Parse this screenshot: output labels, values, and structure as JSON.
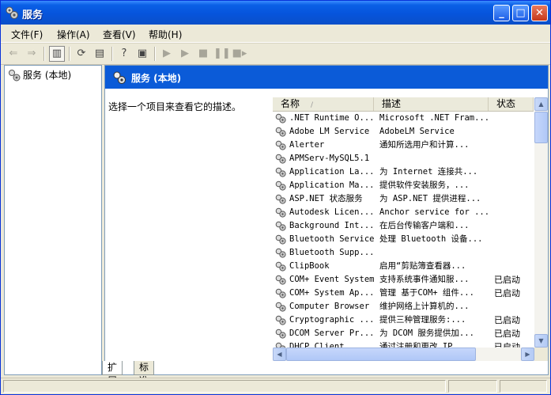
{
  "window": {
    "title": "服务"
  },
  "menu": [
    "文件(F)",
    "操作(A)",
    "查看(V)",
    "帮助(H)"
  ],
  "tree": {
    "root_label": "服务 (本地)"
  },
  "header": {
    "title": "服务 (本地)"
  },
  "description_prompt": "选择一个项目来查看它的描述。",
  "columns": {
    "name": "名称",
    "description": "描述",
    "status": "状态"
  },
  "services": [
    {
      "name": ".NET Runtime O...",
      "description": "Microsoft .NET Fram...",
      "status": ""
    },
    {
      "name": "Adobe LM Service",
      "description": "AdobeLM Service",
      "status": ""
    },
    {
      "name": "Alerter",
      "description": "通知所选用户和计算...",
      "status": ""
    },
    {
      "name": "APMServ-MySQL5.1",
      "description": "",
      "status": ""
    },
    {
      "name": "Application La...",
      "description": "为 Internet 连接共...",
      "status": ""
    },
    {
      "name": "Application Ma...",
      "description": "提供软件安装服务，...",
      "status": ""
    },
    {
      "name": "ASP.NET 状态服务",
      "description": "为 ASP.NET 提供进程...",
      "status": ""
    },
    {
      "name": "Autodesk Licen...",
      "description": "Anchor service for ...",
      "status": ""
    },
    {
      "name": "Background Int...",
      "description": "在后台传输客户端和...",
      "status": ""
    },
    {
      "name": "Bluetooth Service",
      "description": "处理 Bluetooth 设备...",
      "status": ""
    },
    {
      "name": "Bluetooth Supp...",
      "description": "",
      "status": ""
    },
    {
      "name": "ClipBook",
      "description": "启用“剪贴簿查看器...",
      "status": ""
    },
    {
      "name": "COM+ Event System",
      "description": "支持系统事件通知服...",
      "status": "已启动"
    },
    {
      "name": "COM+ System Ap...",
      "description": "管理 基于COM+ 组件...",
      "status": "已启动"
    },
    {
      "name": "Computer Browser",
      "description": "维护网络上计算机的...",
      "status": ""
    },
    {
      "name": "Cryptographic ...",
      "description": "提供三种管理服务:...",
      "status": "已启动"
    },
    {
      "name": "DCOM Server Pr...",
      "description": "为 DCOM 服务提供加...",
      "status": "已启动"
    },
    {
      "name": "DHCP Client",
      "description": "通过注册和更改 IP ...",
      "status": "已启动"
    }
  ],
  "tabs": [
    "扩展",
    "标准"
  ],
  "toolbar_icons": [
    "back-arrow-icon",
    "forward-arrow-icon",
    "show-hide-tree-icon",
    "refresh-icon",
    "export-list-icon",
    "help-icon",
    "properties-icon",
    "start-service-icon",
    "stop-service-icon",
    "pause-service-icon",
    "restart-service-icon"
  ],
  "colors": {
    "title_bar": "#0654dc",
    "header_band": "#0b5bd8",
    "frame": "#ece9d8"
  }
}
